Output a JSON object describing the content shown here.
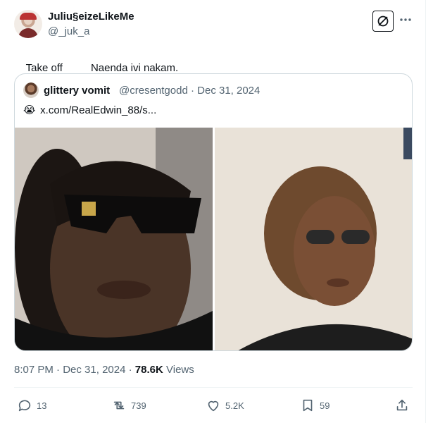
{
  "tweet": {
    "author_name": "Juliu§eizeLikeMe",
    "author_handle": "@_juk_a",
    "text_left": "Take off",
    "text_right": "Naenda ivi nakam.",
    "time": "8:07 PM",
    "date": "Dec 31, 2024",
    "views_count": "78.6K",
    "views_label": "Views"
  },
  "quote": {
    "author_name": "glittery vomit",
    "author_handle": "@cresentgodd",
    "separator": "·",
    "date": "Dec 31, 2024",
    "text": "x.com/RealEdwin_88/s...",
    "emoji": "😭"
  },
  "actions": {
    "replies": "13",
    "reposts": "739",
    "likes": "5.2K",
    "bookmarks": "59"
  },
  "icons": [
    "grok-icon",
    "more-icon",
    "reply-icon",
    "repost-icon",
    "like-icon",
    "bookmark-icon",
    "share-icon"
  ],
  "colors": {
    "text": "#0f1419",
    "secondary": "#536471",
    "border": "#cfd9de"
  }
}
